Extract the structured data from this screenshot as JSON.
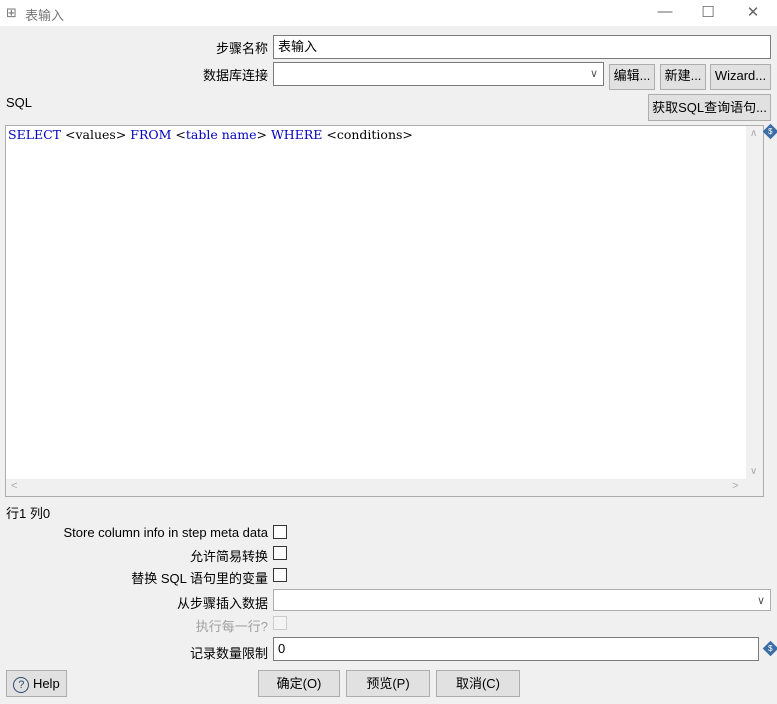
{
  "window": {
    "title": "表输入",
    "minimize": "—",
    "maximize": "☐",
    "close": "✕"
  },
  "form": {
    "step_name_label": "步骤名称",
    "step_name_value": "表输入",
    "db_conn_label": "数据库连接",
    "db_conn_value": "",
    "edit_button": "编辑...",
    "new_button": "新建...",
    "wizard_button": "Wizard...",
    "sql_label": "SQL",
    "get_sql_button": "获取SQL查询语句...",
    "sql": {
      "kw1": "SELECT",
      "t1": " <values> ",
      "kw2": "FROM",
      "t2": " <",
      "kw3": "table name",
      "t3": "> ",
      "kw4": "WHERE",
      "t4": " <conditions>"
    },
    "cursor_pos": "行1 列0",
    "store_column_label": "Store column info in step meta data",
    "lazy_conversion_label": "允许简易转换",
    "replace_vars_label": "替换 SQL 语句里的变量",
    "insert_from_step_label": "从步骤插入数据",
    "insert_from_step_value": "",
    "execute_each_row_label": "执行每一行?",
    "limit_label": "记录数量限制",
    "limit_value": "0"
  },
  "buttons": {
    "help": "Help",
    "ok": "确定(O)",
    "preview": "预览(P)",
    "cancel": "取消(C)"
  }
}
